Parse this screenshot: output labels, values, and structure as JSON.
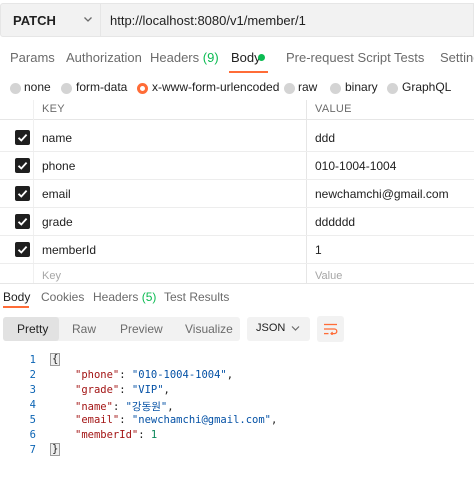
{
  "request": {
    "method": "PATCH",
    "url": "http://localhost:8080/v1/member/1"
  },
  "request_tabs": [
    {
      "label": "Params"
    },
    {
      "label": "Authorization"
    },
    {
      "label": "Headers",
      "count": "(9)"
    },
    {
      "label": "Body"
    },
    {
      "label": "Pre-request Script"
    },
    {
      "label": "Tests"
    },
    {
      "label": "Settings"
    }
  ],
  "body_types": [
    "none",
    "form-data",
    "x-www-form-urlencoded",
    "raw",
    "binary",
    "GraphQL"
  ],
  "body_type_selected": "x-www-form-urlencoded",
  "table": {
    "key_header": "KEY",
    "value_header": "VALUE",
    "rows": [
      {
        "key": "name",
        "value": "ddd"
      },
      {
        "key": "phone",
        "value": "010-1004-1004"
      },
      {
        "key": "email",
        "value": "newchamchi@gmail.com"
      },
      {
        "key": "grade",
        "value": "dddddd"
      },
      {
        "key": "memberId",
        "value": "1"
      }
    ],
    "key_placeholder": "Key",
    "value_placeholder": "Value"
  },
  "response_tabs": [
    {
      "label": "Body"
    },
    {
      "label": "Cookies"
    },
    {
      "label": "Headers",
      "count": "(5)"
    },
    {
      "label": "Test Results"
    }
  ],
  "view_modes": [
    "Pretty",
    "Raw",
    "Preview",
    "Visualize"
  ],
  "format": "JSON",
  "response_lines": [
    {
      "num": "1",
      "open": "{"
    },
    {
      "num": "2",
      "key": "\"phone\"",
      "value": "\"010-1004-1004\"",
      "comma": ","
    },
    {
      "num": "3",
      "key": "\"grade\"",
      "value": "\"VIP\"",
      "comma": ","
    },
    {
      "num": "4",
      "key": "\"name\"",
      "value": "\"강동원\"",
      "comma": ","
    },
    {
      "num": "5",
      "key": "\"email\"",
      "value": "\"newchamchi@gmail.com\"",
      "comma": ","
    },
    {
      "num": "6",
      "key": "\"memberId\"",
      "value": "1",
      "comma": ""
    },
    {
      "num": "7",
      "close": "}"
    }
  ],
  "colors": {
    "accent": "#ff6c37",
    "count": "#0cbb52"
  }
}
